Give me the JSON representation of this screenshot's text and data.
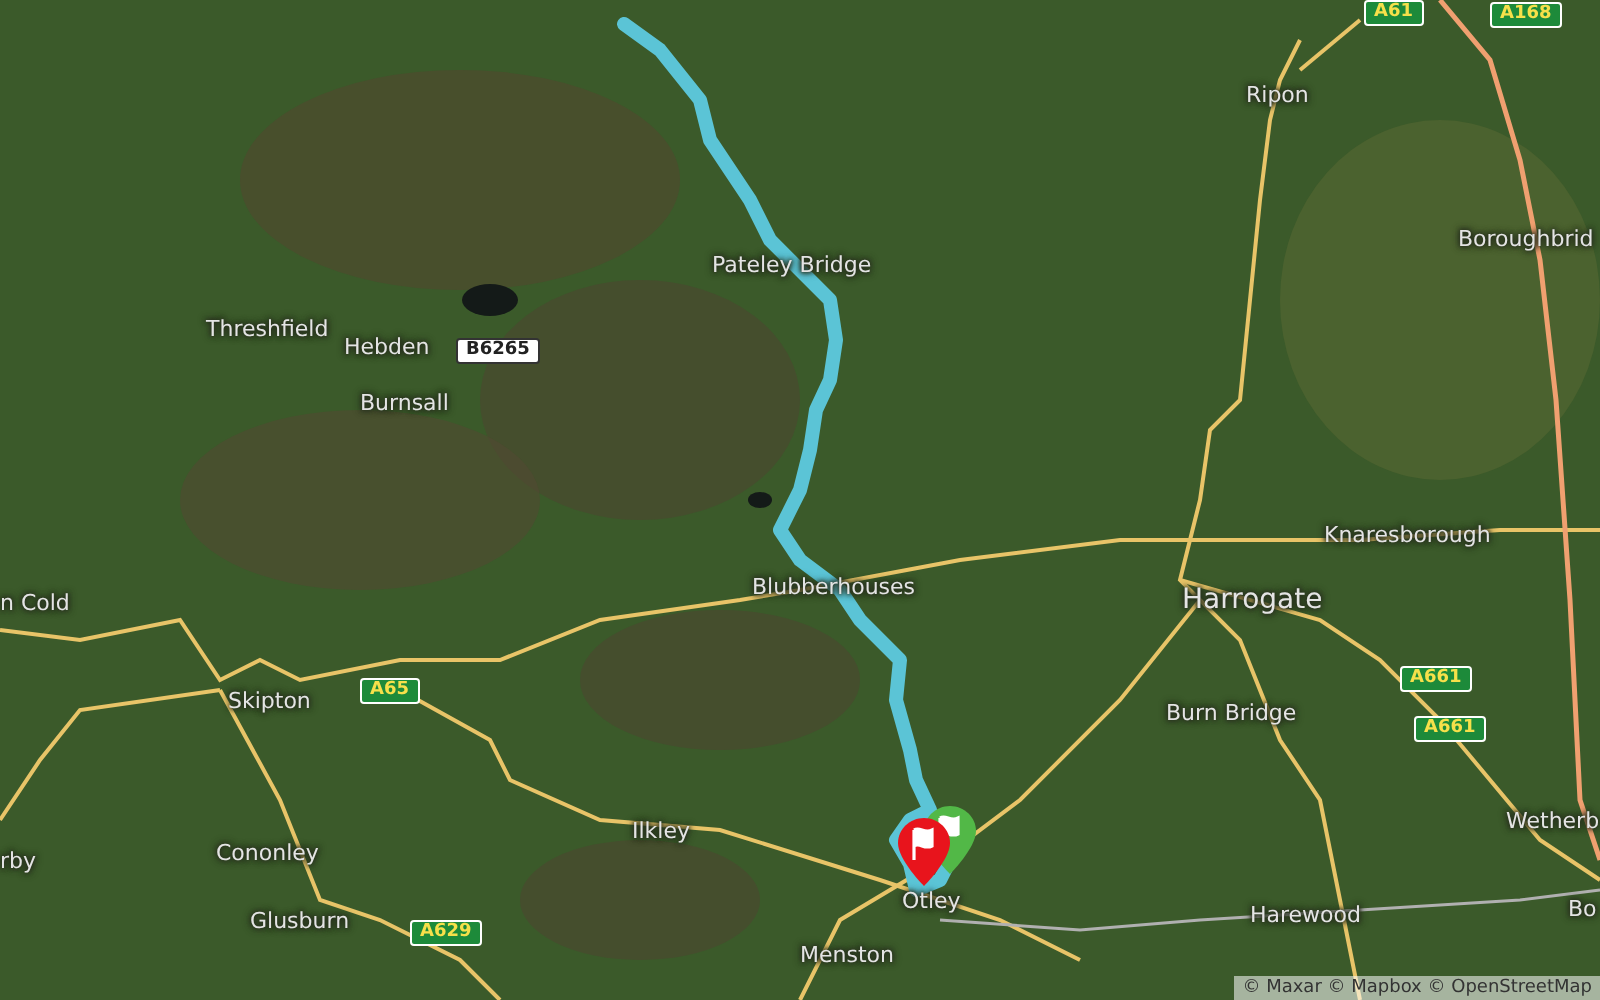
{
  "map": {
    "places": [
      {
        "text": "Threshfield"
      },
      {
        "text": "Hebden"
      },
      {
        "text": "Burnsall"
      },
      {
        "text": "Pateley Bridge"
      },
      {
        "text": "Ripon"
      },
      {
        "text": "Boroughbrid"
      },
      {
        "text": "Knaresborough"
      },
      {
        "text": "Harrogate"
      },
      {
        "text": "Burn Bridge"
      },
      {
        "text": "Blubberhouses"
      },
      {
        "text": "n Cold"
      },
      {
        "text": "Skipton"
      },
      {
        "text": "Cononley"
      },
      {
        "text": "rby"
      },
      {
        "text": "Glusburn"
      },
      {
        "text": "Ilkley"
      },
      {
        "text": "Otley"
      },
      {
        "text": "Menston"
      },
      {
        "text": "Harewood"
      },
      {
        "text": "Wetherb"
      },
      {
        "text": "Bo"
      }
    ],
    "road_shields": [
      {
        "text": "A61",
        "kind": "primary"
      },
      {
        "text": "A168",
        "kind": "primary"
      },
      {
        "text": "B6265",
        "kind": "secondary"
      },
      {
        "text": "A65",
        "kind": "primary"
      },
      {
        "text": "A629",
        "kind": "primary"
      },
      {
        "text": "A661",
        "kind": "primary"
      },
      {
        "text": "A661",
        "kind": "primary"
      }
    ],
    "markers": [
      {
        "kind": "flag",
        "color": "#52b847"
      },
      {
        "kind": "flag",
        "color": "#e8141c"
      }
    ],
    "attribution": "© Maxar © Mapbox © OpenStreetMap"
  }
}
